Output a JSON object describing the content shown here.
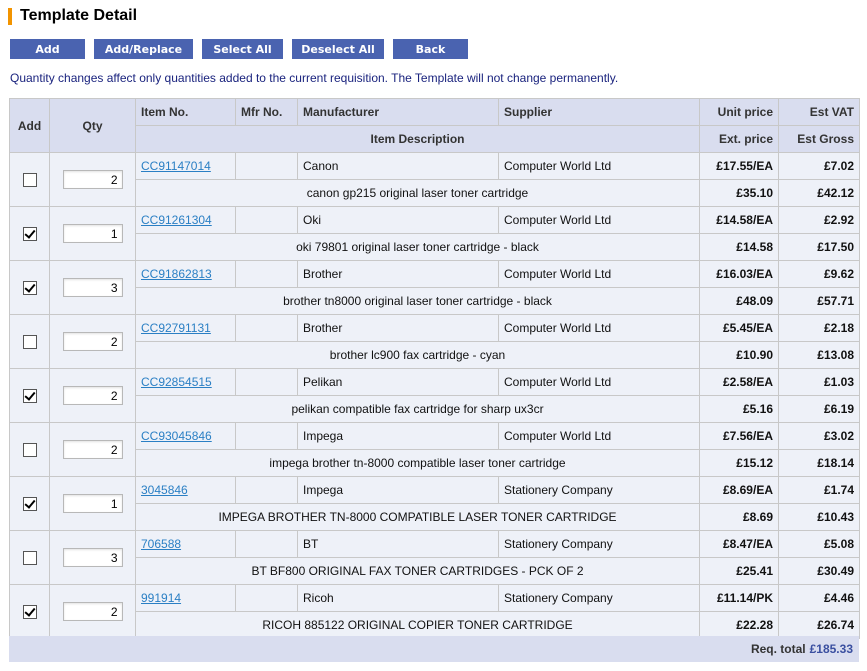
{
  "page": {
    "title": "Template Detail",
    "accent_color": "#f29400",
    "button_color": "#4a63b0"
  },
  "toolbar": {
    "add": "Add",
    "add_replace": "Add/Replace",
    "select_all": "Select All",
    "deselect_all": "Deselect All",
    "back": "Back"
  },
  "note": "Quantity changes affect only quantities added to the current requisition. The Template will not change permanently.",
  "table": {
    "headers": {
      "add": "Add",
      "qty": "Qty",
      "item_no": "Item No.",
      "mfr_no": "Mfr No.",
      "manufacturer": "Manufacturer",
      "supplier": "Supplier",
      "unit_price": "Unit price",
      "est_vat": "Est VAT",
      "item_description": "Item Description",
      "ext_price": "Ext. price",
      "est_gross": "Est Gross"
    },
    "rows": [
      {
        "checked": false,
        "qty": "2",
        "item_no": "CC91147014",
        "mfr_no": "",
        "manufacturer": "Canon",
        "supplier": "Computer World Ltd",
        "unit_price": "£17.55/EA",
        "est_vat": "£7.02",
        "description": "canon gp215 original laser toner cartridge",
        "ext_price": "£35.10",
        "est_gross": "£42.12"
      },
      {
        "checked": true,
        "qty": "1",
        "item_no": "CC91261304",
        "mfr_no": "",
        "manufacturer": "Oki",
        "supplier": "Computer World Ltd",
        "unit_price": "£14.58/EA",
        "est_vat": "£2.92",
        "description": "oki 79801 original laser toner cartridge - black",
        "ext_price": "£14.58",
        "est_gross": "£17.50"
      },
      {
        "checked": true,
        "qty": "3",
        "item_no": "CC91862813",
        "mfr_no": "",
        "manufacturer": "Brother",
        "supplier": "Computer World Ltd",
        "unit_price": "£16.03/EA",
        "est_vat": "£9.62",
        "description": "brother tn8000 original laser toner cartridge - black",
        "ext_price": "£48.09",
        "est_gross": "£57.71"
      },
      {
        "checked": false,
        "qty": "2",
        "item_no": "CC92791131",
        "mfr_no": "",
        "manufacturer": "Brother",
        "supplier": "Computer World Ltd",
        "unit_price": "£5.45/EA",
        "est_vat": "£2.18",
        "description": "brother lc900 fax cartridge - cyan",
        "ext_price": "£10.90",
        "est_gross": "£13.08"
      },
      {
        "checked": true,
        "qty": "2",
        "item_no": "CC92854515",
        "mfr_no": "",
        "manufacturer": "Pelikan",
        "supplier": "Computer World Ltd",
        "unit_price": "£2.58/EA",
        "est_vat": "£1.03",
        "description": "pelikan compatible fax cartridge for sharp ux3cr",
        "ext_price": "£5.16",
        "est_gross": "£6.19"
      },
      {
        "checked": false,
        "qty": "2",
        "item_no": "CC93045846",
        "mfr_no": "",
        "manufacturer": "Impega",
        "supplier": "Computer World Ltd",
        "unit_price": "£7.56/EA",
        "est_vat": "£3.02",
        "description": "impega brother tn-8000 compatible laser toner cartridge",
        "ext_price": "£15.12",
        "est_gross": "£18.14"
      },
      {
        "checked": true,
        "qty": "1",
        "item_no": "3045846",
        "mfr_no": "",
        "manufacturer": "Impega",
        "supplier": "Stationery Company",
        "unit_price": "£8.69/EA",
        "est_vat": "£1.74",
        "description": "IMPEGA BROTHER TN-8000 COMPATIBLE LASER TONER CARTRIDGE",
        "ext_price": "£8.69",
        "est_gross": "£10.43"
      },
      {
        "checked": false,
        "qty": "3",
        "item_no": "706588",
        "mfr_no": "",
        "manufacturer": "BT",
        "supplier": "Stationery Company",
        "unit_price": "£8.47/EA",
        "est_vat": "£5.08",
        "description": "BT BF800 ORIGINAL FAX TONER CARTRIDGES - PCK OF 2",
        "ext_price": "£25.41",
        "est_gross": "£30.49"
      },
      {
        "checked": true,
        "qty": "2",
        "item_no": "991914",
        "mfr_no": "",
        "manufacturer": "Ricoh",
        "supplier": "Stationery Company",
        "unit_price": "£11.14/PK",
        "est_vat": "£4.46",
        "description": "RICOH 885122 ORIGINAL COPIER TONER CARTRIDGE",
        "ext_price": "£22.28",
        "est_gross": "£26.74"
      }
    ]
  },
  "footer": {
    "label": "Req. total",
    "total": "£185.33"
  }
}
